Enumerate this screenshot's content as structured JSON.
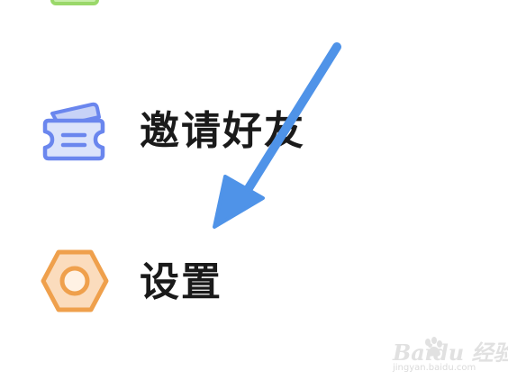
{
  "menu": {
    "items": [
      {
        "label": "邀请好友",
        "icon": "ticket-icon"
      },
      {
        "label": "设置",
        "icon": "hexagon-nut-icon"
      }
    ]
  },
  "colors": {
    "label_text": "#1a1a1a",
    "ticket_icon": "#6a86ee",
    "settings_icon": "#efa04c",
    "top_icon_partial": "#9ad86a",
    "annotation_arrow": "#4f93e8"
  },
  "watermark": {
    "brand": "Baidu 经验",
    "url": "jingyan.baidu.com"
  }
}
